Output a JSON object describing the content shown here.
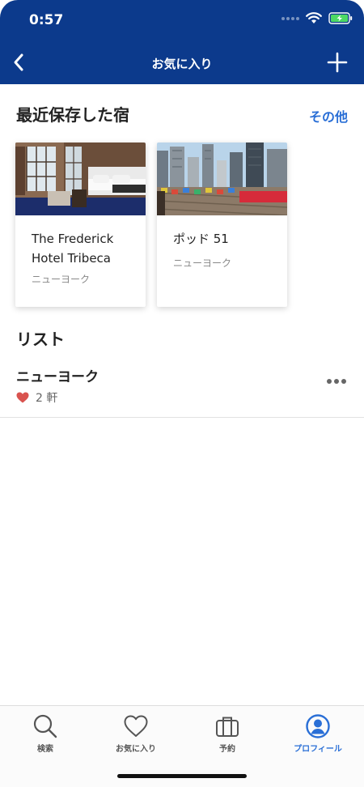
{
  "status": {
    "time": "0:57"
  },
  "nav": {
    "title": "お気に入り"
  },
  "recent": {
    "title": "最近保存した宿",
    "more_label": "その他",
    "cards": [
      {
        "name": "The Frederick Hotel Tribeca",
        "location": "ニューヨーク"
      },
      {
        "name": "ポッド 51",
        "location": "ニューヨーク"
      }
    ]
  },
  "lists": {
    "title": "リスト",
    "items": [
      {
        "name": "ニューヨーク",
        "count": "2 軒"
      }
    ]
  },
  "tabbar": {
    "tabs": [
      {
        "label": "検索",
        "icon": "search-icon"
      },
      {
        "label": "お気に入り",
        "icon": "heart-icon"
      },
      {
        "label": "予約",
        "icon": "briefcase-icon"
      },
      {
        "label": "プロフィール",
        "icon": "profile-icon"
      }
    ],
    "active_color": "#2a6fd6"
  },
  "colors": {
    "header": "#0c3a8c",
    "accent": "#2a6fd6",
    "heart": "#d9534f"
  }
}
